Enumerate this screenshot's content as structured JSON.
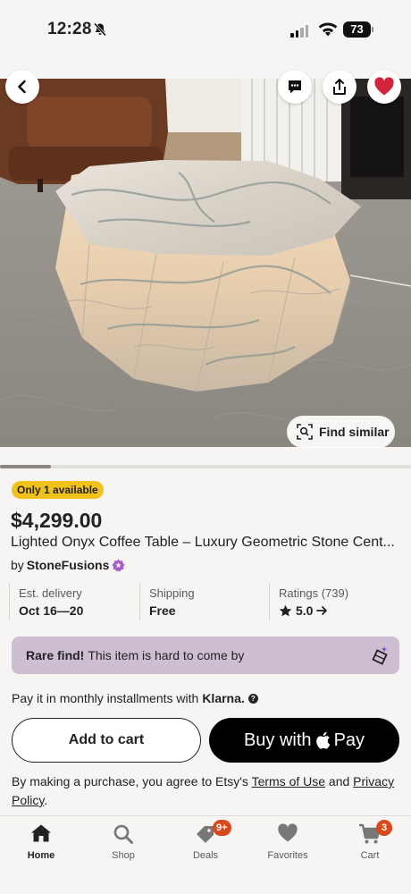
{
  "status_bar": {
    "time": "12:28",
    "battery": "73"
  },
  "listing": {
    "availability_badge": "Only 1 available",
    "price": "$4,299.00",
    "title": "Lighted Onyx Coffee Table – Luxury Geometric Stone Cent...",
    "seller_prefix": "by",
    "seller_name": "StoneFusions",
    "find_similar": "Find similar"
  },
  "info": {
    "delivery_label": "Est. delivery",
    "delivery_value": "Oct 16—20",
    "shipping_label": "Shipping",
    "shipping_value": "Free",
    "ratings_label": "Ratings (739)",
    "ratings_value": "5.0"
  },
  "rare": {
    "title": "Rare find!",
    "text": "This item is hard to come by"
  },
  "klarna": {
    "text": "Pay it in monthly installments with",
    "brand": "Klarna."
  },
  "buttons": {
    "add_to_cart": "Add to cart",
    "buy_with": "Buy with",
    "pay": "Pay"
  },
  "legal": {
    "prefix": "By making a purchase, you agree to Etsy's",
    "terms": "Terms of Use",
    "and": "and",
    "privacy": "Privacy Policy",
    "suffix": "."
  },
  "tabs": [
    {
      "label": "Home"
    },
    {
      "label": "Shop"
    },
    {
      "label": "Deals",
      "badge": "9+"
    },
    {
      "label": "Favorites"
    },
    {
      "label": "Cart",
      "badge": "3"
    }
  ],
  "colors": {
    "accent_orange": "#d64a1e",
    "badge_yellow": "#f1c21b",
    "rare_banner": "#cdbfd1",
    "favorite_red": "#d0253b"
  },
  "icons": [
    "bell-off-icon",
    "back-arrow-icon",
    "message-icon",
    "share-icon",
    "heart-icon",
    "scan-icon",
    "star-icon",
    "diamond-icon",
    "apple-icon",
    "home-icon",
    "search-icon",
    "deals-tag-icon",
    "favorites-heart-icon",
    "cart-icon"
  ]
}
